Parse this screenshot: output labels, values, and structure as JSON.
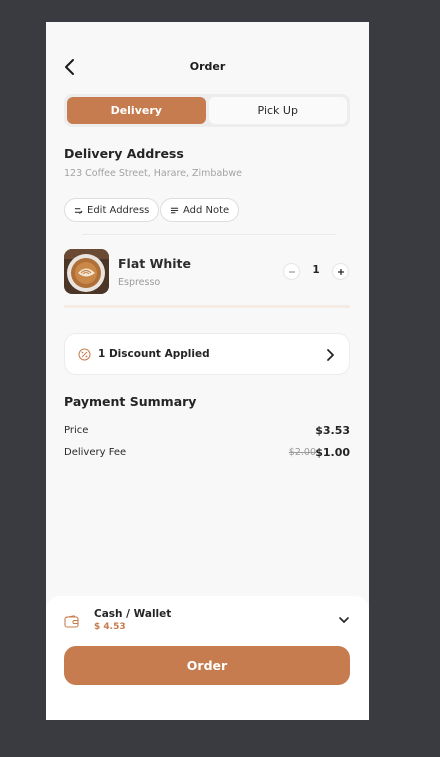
{
  "header": {
    "title": "Order",
    "back_icon": "chevron-left-icon"
  },
  "tabs": [
    {
      "label": "Delivery",
      "active": true
    },
    {
      "label": "Pick Up",
      "active": false
    }
  ],
  "address": {
    "title": "Delivery Address",
    "text": "123 Coffee Street, Harare, Zimbabwe",
    "edit_label": "Edit Address",
    "note_label": "Add Note"
  },
  "item": {
    "name": "Flat White",
    "subtitle": "Espresso",
    "quantity": "1",
    "image": "coffee-cup-image"
  },
  "discount": {
    "label": "1 Discount Applied",
    "icon": "discount-icon"
  },
  "payment": {
    "title": "Payment Summary",
    "price_label": "Price",
    "price_value": "$3.53",
    "fee_label": "Delivery Fee",
    "fee_original": "$2.00",
    "fee_value": "$1.00"
  },
  "wallet": {
    "name": "Cash / Wallet",
    "amount": "$ 4.53",
    "icon": "wallet-icon"
  },
  "order_button": "Order",
  "colors": {
    "accent": "#c67c4e",
    "background": "#f8f8f8",
    "outer": "#3a3b40"
  }
}
